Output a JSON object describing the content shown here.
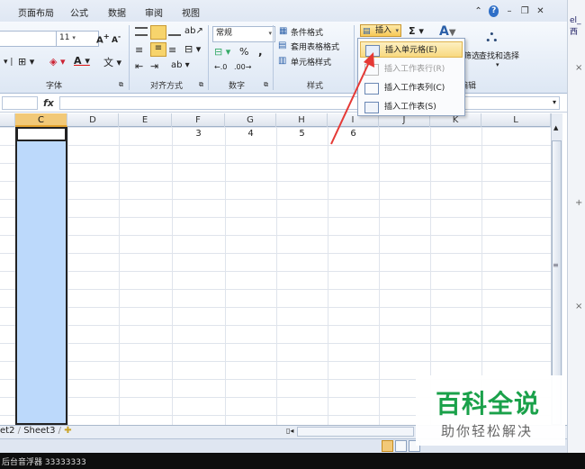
{
  "menu_tabs": [
    "页面布局",
    "公式",
    "数据",
    "审阅",
    "视图"
  ],
  "ribbon": {
    "font_size": "11",
    "font_group_label": "字体",
    "number_format": "常规",
    "align_group_label": "对齐方式",
    "number_group_label": "数字",
    "style_group_label": "样式",
    "cond_format": "条件格式",
    "table_format": "套用表格格式",
    "cell_style": "单元格样式",
    "insert_label": "插入",
    "edit_group_label": "编辑",
    "find_select": "查找和选择",
    "filter_partial": "筛选",
    "percent": "%",
    "comma": ","
  },
  "insert_menu": {
    "items": [
      {
        "label": "插入单元格(E)",
        "highlighted": true,
        "disabled": false
      },
      {
        "label": "插入工作表行(R)",
        "highlighted": false,
        "disabled": true
      },
      {
        "label": "插入工作表列(C)",
        "highlighted": false,
        "disabled": false
      },
      {
        "label": "插入工作表(S)",
        "highlighted": false,
        "disabled": false
      }
    ]
  },
  "formula_bar": {
    "fx": "fx",
    "value": ""
  },
  "columns": [
    "C",
    "D",
    "E",
    "F",
    "G",
    "H",
    "I",
    "J",
    "K",
    "L"
  ],
  "selected_column": "C",
  "row1_values": {
    "F": "3",
    "G": "4",
    "H": "5",
    "I": "6"
  },
  "sheet_tabs": [
    "et2",
    "Sheet3"
  ],
  "taskbar_text": "后台音浮器  33333333",
  "watermark": {
    "title": "百科全说",
    "subtitle": "助你轻松解决"
  },
  "colors": {
    "accent": "#1aa14a",
    "highlight": "#f8d97f",
    "selection": "#bcd9fb",
    "arrow": "#e53935"
  }
}
